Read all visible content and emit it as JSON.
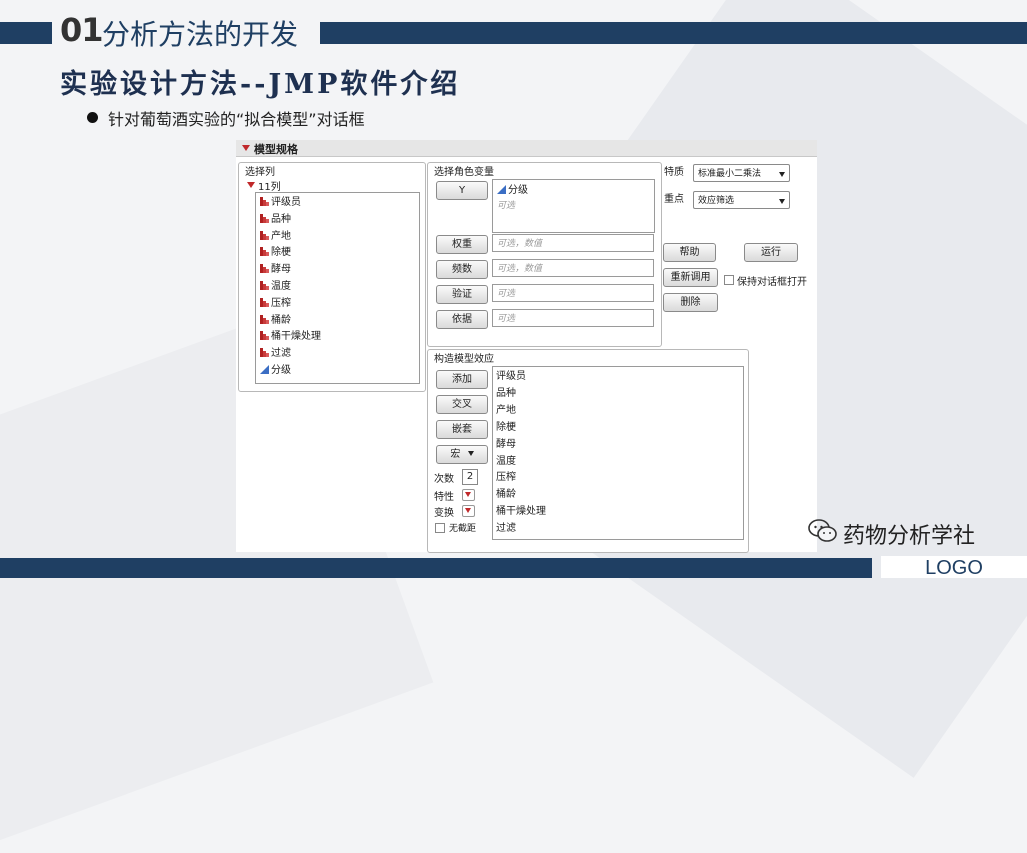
{
  "header": {
    "number": "01",
    "title": "分析方法的开发"
  },
  "subtitle": "实验设计方法--JMP软件介绍",
  "bullet": "针对葡萄酒实验的“拟合模型”对话框",
  "footer": {
    "logo": "LOGO",
    "watermark": "药物分析学社"
  },
  "dialog": {
    "title": "模型规格",
    "select_columns": {
      "label": "选择列",
      "count_label": "11列",
      "columns": [
        {
          "name": "评级员",
          "type": "nominal"
        },
        {
          "name": "品种",
          "type": "nominal"
        },
        {
          "name": "产地",
          "type": "nominal"
        },
        {
          "name": "除梗",
          "type": "nominal"
        },
        {
          "name": "酵母",
          "type": "nominal"
        },
        {
          "name": "温度",
          "type": "nominal"
        },
        {
          "name": "压榨",
          "type": "nominal"
        },
        {
          "name": "桶龄",
          "type": "nominal"
        },
        {
          "name": "桶干燥处理",
          "type": "nominal"
        },
        {
          "name": "过滤",
          "type": "nominal"
        },
        {
          "name": "分级",
          "type": "continuous"
        }
      ]
    },
    "roles": {
      "label": "选择角色变量",
      "y_button": "Y",
      "y_value": "分级",
      "y_optional": "可选",
      "rows": [
        {
          "button": "权重",
          "placeholder": "可选，数值"
        },
        {
          "button": "频数",
          "placeholder": "可选，数值"
        },
        {
          "button": "验证",
          "placeholder": "可选"
        },
        {
          "button": "依据",
          "placeholder": "可选"
        }
      ]
    },
    "personality_label": "特质",
    "personality_value": "标准最小二乘法",
    "emphasis_label": "重点",
    "emphasis_value": "效应筛选",
    "buttons": {
      "help": "帮助",
      "run": "运行",
      "recall": "重新调用",
      "remove": "删除"
    },
    "keep_open_label": "保持对话框打开",
    "effects": {
      "label": "构造模型效应",
      "add": "添加",
      "cross": "交叉",
      "nest": "嵌套",
      "macros": "宏",
      "degree_label": "次数",
      "degree_value": "2",
      "attributes_label": "特性",
      "transform_label": "变换",
      "no_intercept_label": "无截距",
      "items": [
        "评级员",
        "品种",
        "产地",
        "除梗",
        "酵母",
        "温度",
        "压榨",
        "桶龄",
        "桶干燥处理",
        "过滤"
      ]
    }
  }
}
